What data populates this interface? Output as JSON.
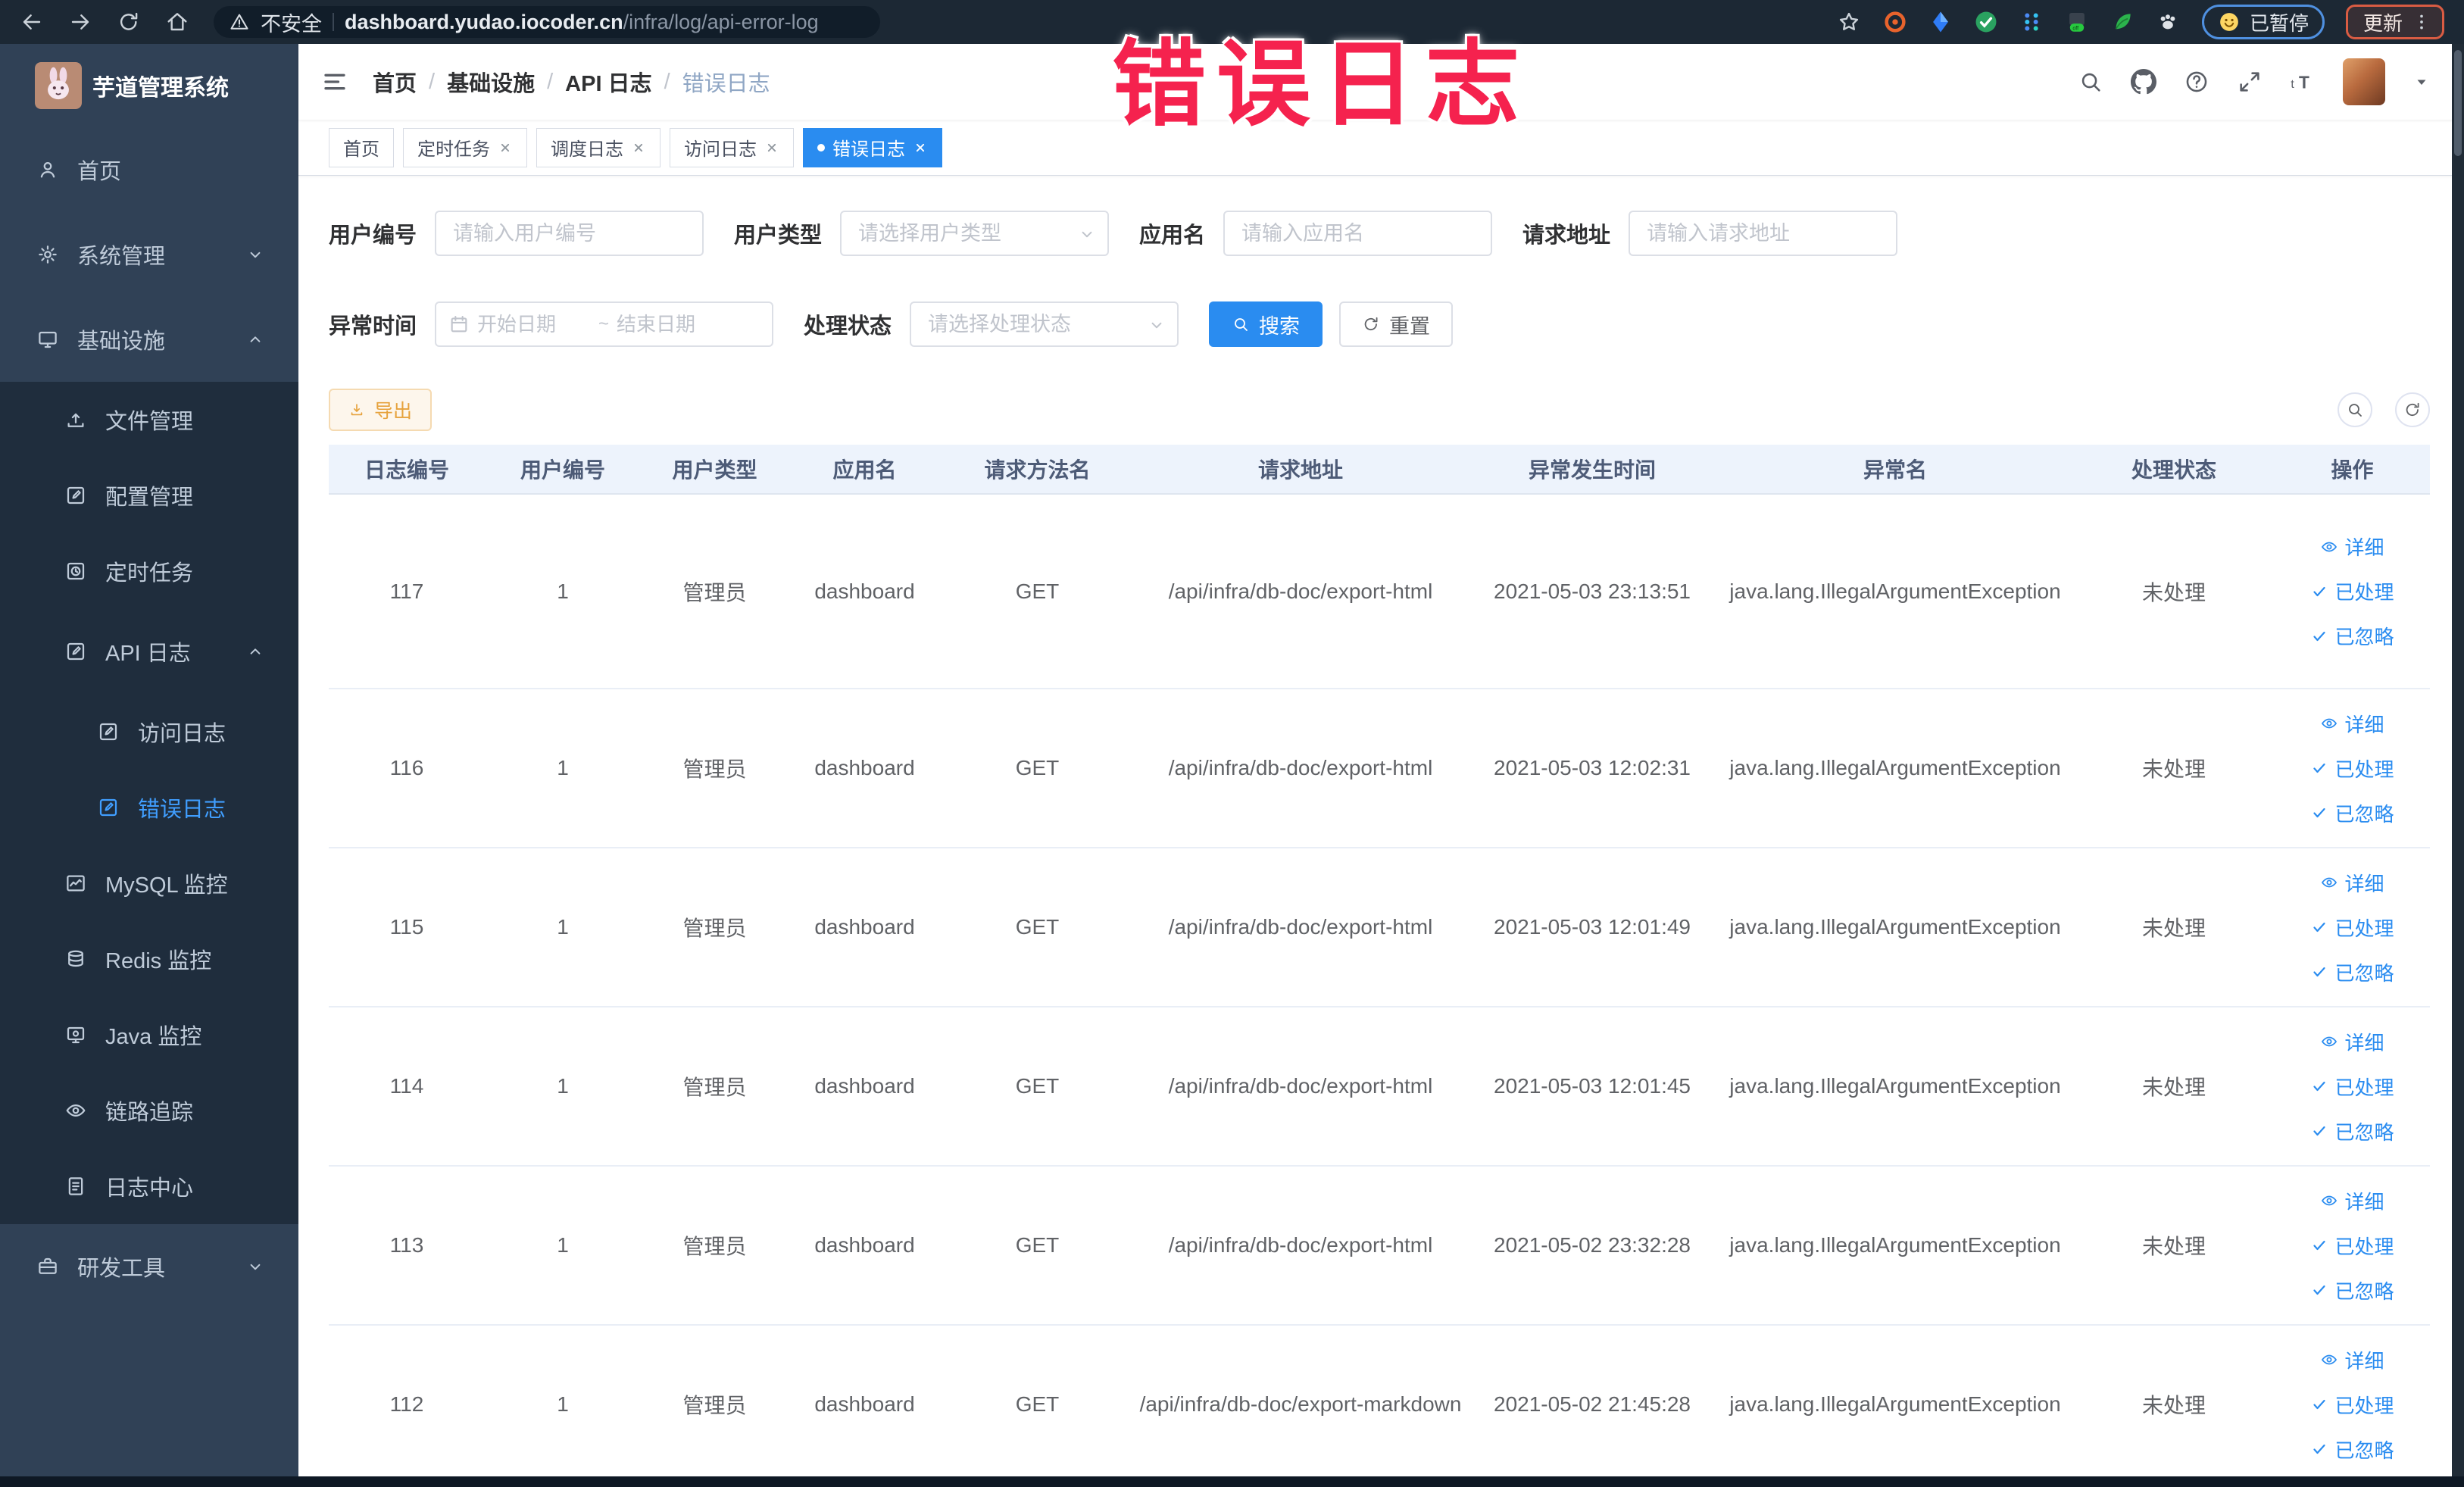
{
  "browser": {
    "security_label": "不安全",
    "url_host": "dashboard.yudao.iocoder.cn",
    "url_path": "/infra/log/api-error-log",
    "translate_status": "已暂停",
    "update_label": "更新",
    "extension_icons": [
      "extension-target-icon",
      "extension-kite-icon",
      "extension-green-check-icon",
      "extension-grid-icon",
      "extension-off-badge-icon",
      "extension-leaf-icon",
      "extension-paw-icon"
    ]
  },
  "annotation": {
    "text": "错误日志",
    "color": "#f5224e"
  },
  "sidebar": {
    "title": "芋道管理系统",
    "items": [
      {
        "label": "首页",
        "icon": "user-icon",
        "level": 0
      },
      {
        "label": "系统管理",
        "icon": "gear-icon",
        "level": 0,
        "chevron": "down"
      },
      {
        "label": "基础设施",
        "icon": "monitor-icon",
        "level": 0,
        "chevron": "up"
      },
      {
        "label": "文件管理",
        "icon": "upload-icon",
        "level": 1
      },
      {
        "label": "配置管理",
        "icon": "edit-square-icon",
        "level": 1
      },
      {
        "label": "定时任务",
        "icon": "timer-icon",
        "level": 1
      },
      {
        "label": "API 日志",
        "icon": "log-icon",
        "level": 1,
        "chevron": "up",
        "tall": true
      },
      {
        "label": "访问日志",
        "icon": "log-icon",
        "level": 2
      },
      {
        "label": "错误日志",
        "icon": "log-icon",
        "level": 2,
        "active": true
      },
      {
        "label": "MySQL 监控",
        "icon": "chart-icon",
        "level": 1
      },
      {
        "label": "Redis 监控",
        "icon": "stack-icon",
        "level": 1
      },
      {
        "label": "Java 监控",
        "icon": "java-icon",
        "level": 1
      },
      {
        "label": "链路追踪",
        "icon": "eye-icon",
        "level": 1
      },
      {
        "label": "日志中心",
        "icon": "doc-icon",
        "level": 1
      },
      {
        "label": "研发工具",
        "icon": "tools-icon",
        "level": 0,
        "chevron": "down"
      }
    ]
  },
  "navbar": {
    "breadcrumb": [
      "首页",
      "基础设施",
      "API 日志",
      "错误日志"
    ],
    "separator": "/"
  },
  "tags": [
    {
      "label": "首页",
      "closable": false,
      "active": false
    },
    {
      "label": "定时任务",
      "closable": true,
      "active": false
    },
    {
      "label": "调度日志",
      "closable": true,
      "active": false
    },
    {
      "label": "访问日志",
      "closable": true,
      "active": false
    },
    {
      "label": "错误日志",
      "closable": true,
      "active": true
    }
  ],
  "filters": {
    "user_id": {
      "label": "用户编号",
      "placeholder": "请输入用户编号"
    },
    "user_type": {
      "label": "用户类型",
      "placeholder": "请选择用户类型"
    },
    "app_name": {
      "label": "应用名",
      "placeholder": "请输入应用名"
    },
    "request_url": {
      "label": "请求地址",
      "placeholder": "请输入请求地址"
    },
    "exception_time": {
      "label": "异常时间",
      "start_placeholder": "开始日期",
      "range_separator": "~",
      "end_placeholder": "结束日期"
    },
    "process_status": {
      "label": "处理状态",
      "placeholder": "请选择处理状态"
    },
    "search_label": "搜索",
    "reset_label": "重置"
  },
  "toolbar": {
    "export_label": "导出"
  },
  "table": {
    "columns": [
      "日志编号",
      "用户编号",
      "用户类型",
      "应用名",
      "请求方法名",
      "请求地址",
      "异常发生时间",
      "异常名",
      "处理状态",
      "操作"
    ],
    "rows": [
      {
        "id": "117",
        "user_id": "1",
        "user_type": "管理员",
        "app": "dashboard",
        "method": "GET",
        "url": "/api/infra/db-doc/export-html",
        "time": "2021-05-03 23:13:51",
        "exception": "java.lang.IllegalArgumentException",
        "status": "未处理"
      },
      {
        "id": "116",
        "user_id": "1",
        "user_type": "管理员",
        "app": "dashboard",
        "method": "GET",
        "url": "/api/infra/db-doc/export-html",
        "time": "2021-05-03 12:02:31",
        "exception": "java.lang.IllegalArgumentException",
        "status": "未处理"
      },
      {
        "id": "115",
        "user_id": "1",
        "user_type": "管理员",
        "app": "dashboard",
        "method": "GET",
        "url": "/api/infra/db-doc/export-html",
        "time": "2021-05-03 12:01:49",
        "exception": "java.lang.IllegalArgumentException",
        "status": "未处理"
      },
      {
        "id": "114",
        "user_id": "1",
        "user_type": "管理员",
        "app": "dashboard",
        "method": "GET",
        "url": "/api/infra/db-doc/export-html",
        "time": "2021-05-03 12:01:45",
        "exception": "java.lang.IllegalArgumentException",
        "status": "未处理"
      },
      {
        "id": "113",
        "user_id": "1",
        "user_type": "管理员",
        "app": "dashboard",
        "method": "GET",
        "url": "/api/infra/db-doc/export-html",
        "time": "2021-05-02 23:32:28",
        "exception": "java.lang.IllegalArgumentException",
        "status": "未处理"
      },
      {
        "id": "112",
        "user_id": "1",
        "user_type": "管理员",
        "app": "dashboard",
        "method": "GET",
        "url": "/api/infra/db-doc/export-markdown",
        "time": "2021-05-02 21:45:28",
        "exception": "java.lang.IllegalArgumentException",
        "status": "未处理"
      }
    ],
    "row_actions": [
      "详细",
      "已处理",
      "已忽略"
    ]
  }
}
